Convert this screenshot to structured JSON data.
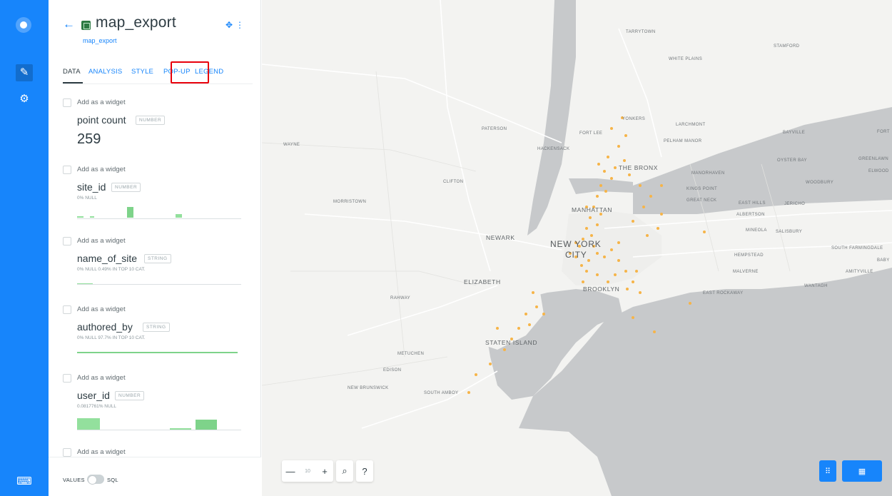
{
  "sidebar": {
    "logo_icon": "carto-logo-icon",
    "items": [
      {
        "icon": "pencil-icon",
        "active": true
      },
      {
        "icon": "sliders-icon",
        "active": false
      }
    ],
    "bottom_icon": "keyboard-icon"
  },
  "header": {
    "title": "map_export",
    "subtitle": "map_export",
    "back_icon": "arrow-left-icon",
    "action_icons": [
      "locate-icon",
      "more-icon"
    ]
  },
  "tabs": [
    {
      "label": "DATA",
      "selected": true
    },
    {
      "label": "ANALYSIS",
      "selected": false
    },
    {
      "label": "STYLE",
      "selected": false,
      "highlighted": true
    },
    {
      "label": "POP-UP",
      "selected": false
    },
    {
      "label": "LEGEND",
      "selected": false
    }
  ],
  "columns": [
    {
      "add_label": "Add as a widget",
      "name": "point count",
      "type": "NUMBER",
      "value": "259"
    },
    {
      "add_label": "Add as a widget",
      "name": "site_id",
      "type": "NUMBER",
      "meta": "0% NULL"
    },
    {
      "add_label": "Add as a widget",
      "name": "name_of_site",
      "type": "STRING",
      "meta": "0% NULL   0.49% IN TOP 10 CAT."
    },
    {
      "add_label": "Add as a widget",
      "name": "authored_by",
      "type": "STRING",
      "meta": "0% NULL   97.7% IN TOP 10 CAT."
    },
    {
      "add_label": "Add as a widget",
      "name": "user_id",
      "type": "NUMBER",
      "meta": "0.0817761% NULL"
    },
    {
      "add_label": "Add as a widget"
    }
  ],
  "footer": {
    "values_label": "VALUES",
    "sql_label": "SQL",
    "toggle_on": false
  },
  "map": {
    "zoom_level": "10",
    "zoom_out": "—",
    "zoom_in": "+",
    "search_icon": "search-icon",
    "help": "?",
    "labels": {
      "nyc": "NEW YORK",
      "city": "CITY",
      "manhattan": "MANHATTAN",
      "brooklyn": "BROOKLYN",
      "bronx": "THE BRONX",
      "staten": "STATEN ISLAND",
      "newark": "NEWARK",
      "elizabeth": "ELIZABETH",
      "yonkers": "YONKERS",
      "white_plains": "WHITE PLAINS",
      "stamford": "STAMFORD",
      "hempstead": "HEMPSTEAD",
      "paterson": "PATERSON",
      "tarrytown": "TARRYTOWN",
      "pelham": "PELHAM MANOR",
      "far_rockaway": "EAST ROCKAWAY",
      "bayville": "BAYVILLE",
      "oyster_bay": "OYSTER BAY",
      "woodbury": "WOODBURY",
      "jericho": "JERICHO",
      "salisbury": "SALISBURY",
      "mineola": "MINEOLA",
      "valley_stream": "MALVERNE",
      "south_amboy": "SOUTH AMBOY",
      "edison": "EDISON",
      "new_brunswick": "NEW BRUNSWICK",
      "metuchen": "METUCHEN",
      "rahway": "RAHWAY",
      "morristown": "MORRISTOWN",
      "wayne": "WAYNE",
      "clifton": "CLIFTON",
      "hackensack": "HACKENSACK",
      "fort_lee": "FORT LEE",
      "lindenhurst": "AMITYVILLE",
      "wantagh": "WANTAGH",
      "south_farmingdale": "SOUTH FARMINGDALE",
      "new_rochelle": "LARCHMONT",
      "kings_point": "KINGS POINT",
      "great_neck": "GREAT NECK",
      "port_washington": "MANORHAVEN",
      "albertson": "ALBERTSON",
      "east_hills": "EAST HILLS",
      "greenlawn": "GREENLAWN",
      "elwood": "ELWOOD",
      "fort_salonga": "FORT",
      "babylon": "BABY"
    }
  }
}
